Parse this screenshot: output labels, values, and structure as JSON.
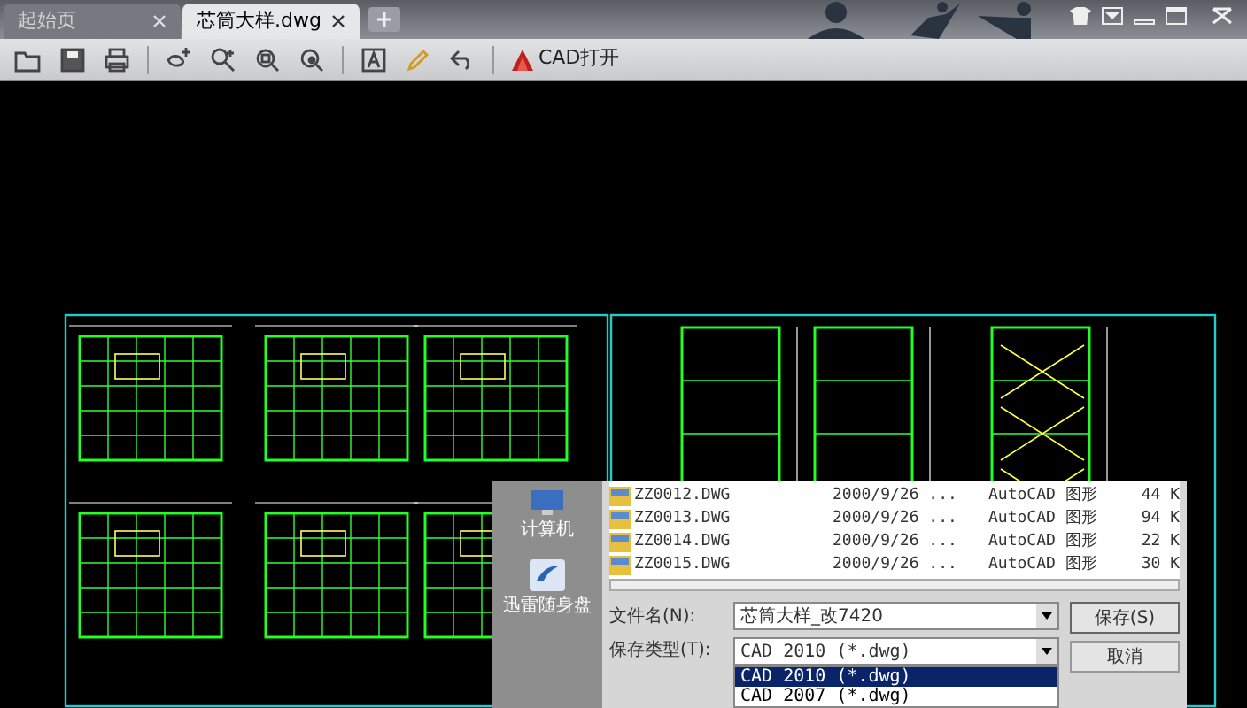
{
  "tabs": [
    {
      "label": "起始页",
      "selected": false
    },
    {
      "label": "芯筒大样.dwg",
      "selected": true
    }
  ],
  "toolbar": {
    "open_label": "CAD打开"
  },
  "save_dialog": {
    "places": [
      {
        "label": "计算机",
        "kind": "computer"
      },
      {
        "label": "迅雷随身盘",
        "kind": "drive"
      }
    ],
    "files": [
      {
        "name": "ZZ0012.DWG",
        "date": "2000/9/26 ...",
        "type": "AutoCAD 图形",
        "size": "44 K"
      },
      {
        "name": "ZZ0013.DWG",
        "date": "2000/9/26 ...",
        "type": "AutoCAD 图形",
        "size": "94 K"
      },
      {
        "name": "ZZ0014.DWG",
        "date": "2000/9/26 ...",
        "type": "AutoCAD 图形",
        "size": "22 K"
      },
      {
        "name": "ZZ0015.DWG",
        "date": "2000/9/26 ...",
        "type": "AutoCAD 图形",
        "size": "30 K"
      }
    ],
    "filename_label": "文件名(N):",
    "filename": "芯筒大样_改7420",
    "filetype_label": "保存类型(T):",
    "filetype": "CAD 2010 (*.dwg)",
    "filetype_options": [
      {
        "label": "CAD 2010 (*.dwg)",
        "selected": true
      },
      {
        "label": "CAD 2007 (*.dwg)",
        "selected": false
      }
    ],
    "save_button": "保存(S)",
    "cancel_button": "取消"
  }
}
